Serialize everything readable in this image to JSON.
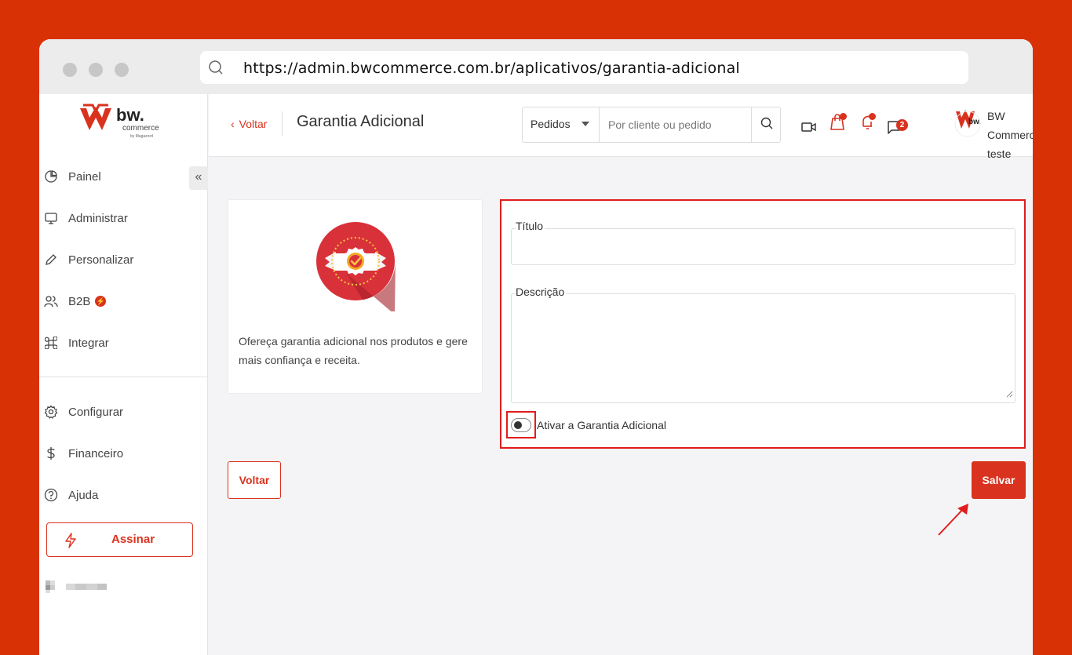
{
  "browser": {
    "url": "https://admin.bwcommerce.com.br/aplicativos/garantia-adicional"
  },
  "brand": {
    "logo_main": "bw.",
    "logo_sub": "commerce",
    "logo_by": "by Magazord",
    "accent": "#d9321e"
  },
  "sidebar": {
    "collapse_label": "«",
    "items": [
      {
        "label": "Painel",
        "icon": "pie-chart-icon"
      },
      {
        "label": "Administrar",
        "icon": "monitor-icon"
      },
      {
        "label": "Personalizar",
        "icon": "pen-icon"
      },
      {
        "label": "B2B",
        "icon": "users-icon"
      },
      {
        "label": "Integrar",
        "icon": "command-icon"
      },
      {
        "label": "Configurar",
        "icon": "gear-icon"
      },
      {
        "label": "Financeiro",
        "icon": "dollar-icon"
      },
      {
        "label": "Ajuda",
        "icon": "help-icon"
      }
    ],
    "b2b_badge": "⚡",
    "subscribe_label": "Assinar"
  },
  "header": {
    "back_label": "Voltar",
    "title": "Garantia Adicional",
    "search": {
      "scope": "Pedidos",
      "placeholder": "Por cliente ou pedido"
    },
    "messages_count": "2",
    "user": {
      "name": "BW Commerce",
      "store": "teste"
    }
  },
  "info_card": {
    "description": "Ofereça garantia adicional nos produtos e gere mais confiança e receita."
  },
  "form": {
    "title_label": "Título",
    "title_value": "",
    "description_label": "Descrição",
    "description_value": "",
    "toggle_label": "Ativar a Garantia Adicional",
    "toggle_on": false
  },
  "actions": {
    "back_label": "Voltar",
    "save_label": "Salvar"
  }
}
